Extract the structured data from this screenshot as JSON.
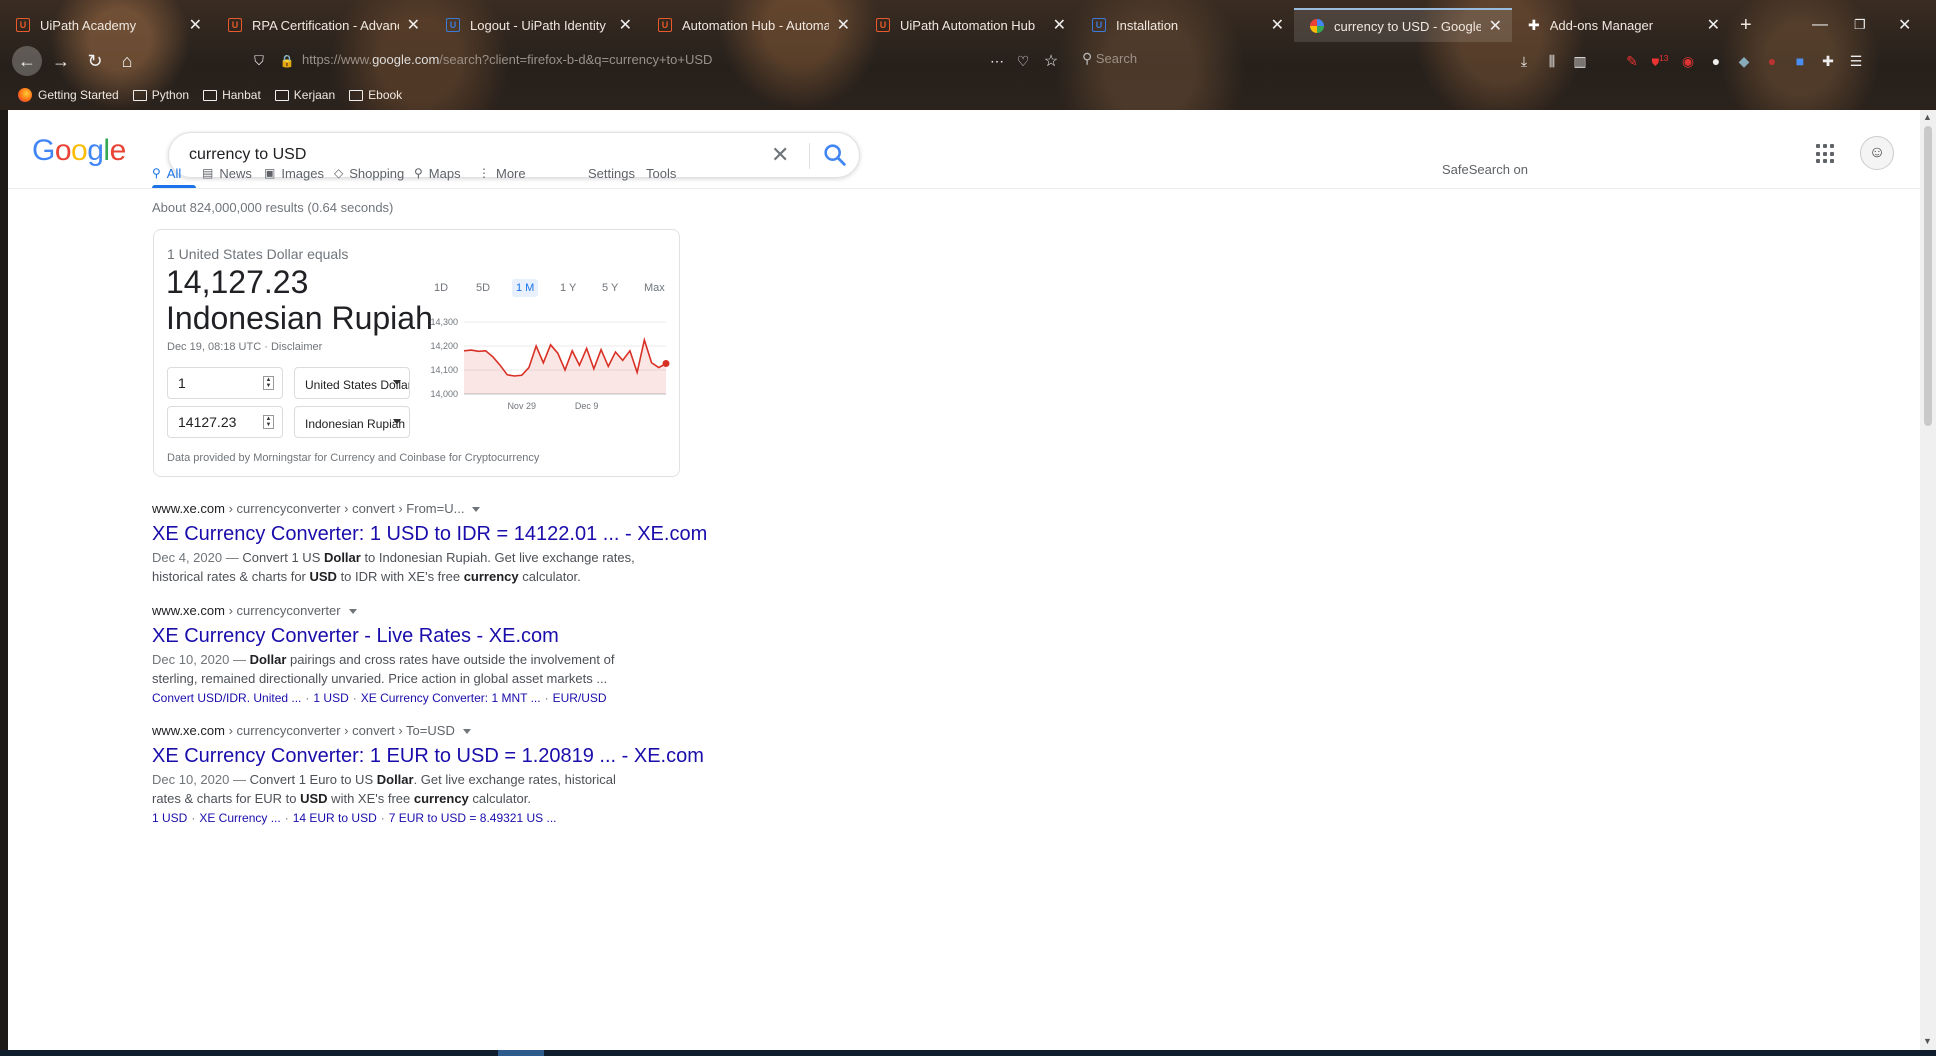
{
  "browser": {
    "tabs": [
      {
        "title": "UiPath Academy",
        "icon": "uipath-icon"
      },
      {
        "title": "RPA Certification - Advanced",
        "icon": "uipath-icon"
      },
      {
        "title": "Logout - UiPath Identity",
        "icon": "uipath-blue-icon"
      },
      {
        "title": "Automation Hub - Automa",
        "icon": "uipath-icon"
      },
      {
        "title": "UiPath Automation Hub",
        "icon": "uipath-icon"
      },
      {
        "title": "Installation",
        "icon": "uipath-blue-icon"
      },
      {
        "title": "currency to USD - Google S",
        "icon": "google-icon"
      },
      {
        "title": "Add-ons Manager",
        "icon": "puzzle-icon"
      }
    ],
    "url_prefix": "https://www.",
    "url_domain": "google.com",
    "url_suffix": "/search?client=firefox-b-d&q=currency+to+USD",
    "search_placeholder": "Search",
    "bookmarks": [
      "Getting Started",
      "Python",
      "Hanbat",
      "Kerjaan",
      "Ebook"
    ],
    "badge": "13"
  },
  "google": {
    "query": "currency to USD",
    "tabs": [
      "All",
      "News",
      "Images",
      "Shopping",
      "Maps",
      "More"
    ],
    "settings": "Settings",
    "tools": "Tools",
    "safesearch": "SafeSearch on",
    "stats": "About 824,000,000 results (0.64 seconds)"
  },
  "converter": {
    "equals": "1 United States Dollar equals",
    "amount": "14,127.23",
    "currency": "Indonesian Rupiah",
    "date_prefix": "Dec 19, 08:18 UTC · ",
    "disclaimer": "Disclaimer",
    "from_value": "1",
    "from_currency": "United States Dollar",
    "to_value": "14127.23",
    "to_currency": "Indonesian Rupiah",
    "ranges": [
      "1D",
      "5D",
      "1 M",
      "1 Y",
      "5 Y",
      "Max"
    ],
    "active_range": "1 M",
    "provider": "Data provided by Morningstar for Currency and Coinbase for Cryptocurrency"
  },
  "chart_data": {
    "type": "area",
    "title": "",
    "ylim": [
      14000,
      14300
    ],
    "y_ticks": [
      "14,300",
      "14,200",
      "14,100",
      "14,000"
    ],
    "y_tick_values": [
      14300,
      14200,
      14100,
      14000
    ],
    "x_tick_labels": [
      "Nov 29",
      "Dec 9"
    ],
    "x_tick_index": [
      8,
      17
    ],
    "series": [
      {
        "values": [
          14180,
          14183,
          14178,
          14180,
          14155,
          14120,
          14080,
          14075,
          14078,
          14110,
          14200,
          14130,
          14205,
          14170,
          14100,
          14180,
          14120,
          14190,
          14105,
          14185,
          14115,
          14175,
          14140,
          14180,
          14090,
          14225,
          14130,
          14110,
          14127
        ]
      }
    ],
    "color": "#d93025"
  },
  "results": [
    {
      "site": "www.xe.com",
      "path": " › currencyconverter › convert › From=U...",
      "title": "XE Currency Converter: 1 USD to IDR = 14122.01 ... - XE.com",
      "date": "Dec 4, 2020 — ",
      "snippet": [
        {
          "t": "Convert 1 US ",
          "b": false
        },
        {
          "t": "Dollar",
          "b": true
        },
        {
          "t": " to Indonesian Rupiah. Get live exchange rates, historical rates & charts for ",
          "b": false
        },
        {
          "t": "USD",
          "b": true
        },
        {
          "t": " to IDR with XE's free ",
          "b": false
        },
        {
          "t": "currency",
          "b": true
        },
        {
          "t": " calculator.",
          "b": false
        }
      ],
      "links": []
    },
    {
      "site": "www.xe.com",
      "path": " › currencyconverter",
      "title": "XE Currency Converter - Live Rates - XE.com",
      "date": "Dec 10, 2020 — ",
      "snippet": [
        {
          "t": "Dollar",
          "b": true
        },
        {
          "t": " pairings and cross rates have outside the involvement of sterling, remained directionally unvaried. Price action in global asset markets ...",
          "b": false
        }
      ],
      "links": [
        "Convert USD/IDR. United ...",
        "1 USD",
        "XE Currency Converter: 1 MNT ...",
        "EUR/USD"
      ]
    },
    {
      "site": "www.xe.com",
      "path": " › currencyconverter › convert › To=USD",
      "title": "XE Currency Converter: 1 EUR to USD = 1.20819 ... - XE.com",
      "date": "Dec 10, 2020 — ",
      "snippet": [
        {
          "t": "Convert 1 Euro to US ",
          "b": false
        },
        {
          "t": "Dollar",
          "b": true
        },
        {
          "t": ". Get live exchange rates, historical rates & charts for EUR to ",
          "b": false
        },
        {
          "t": "USD",
          "b": true
        },
        {
          "t": " with XE's free ",
          "b": false
        },
        {
          "t": "currency",
          "b": true
        },
        {
          "t": " calculator.",
          "b": false
        }
      ],
      "links": [
        "1 USD",
        "XE Currency ...",
        "14 EUR to USD",
        "7 EUR to USD = 8.49321 US ..."
      ]
    }
  ]
}
